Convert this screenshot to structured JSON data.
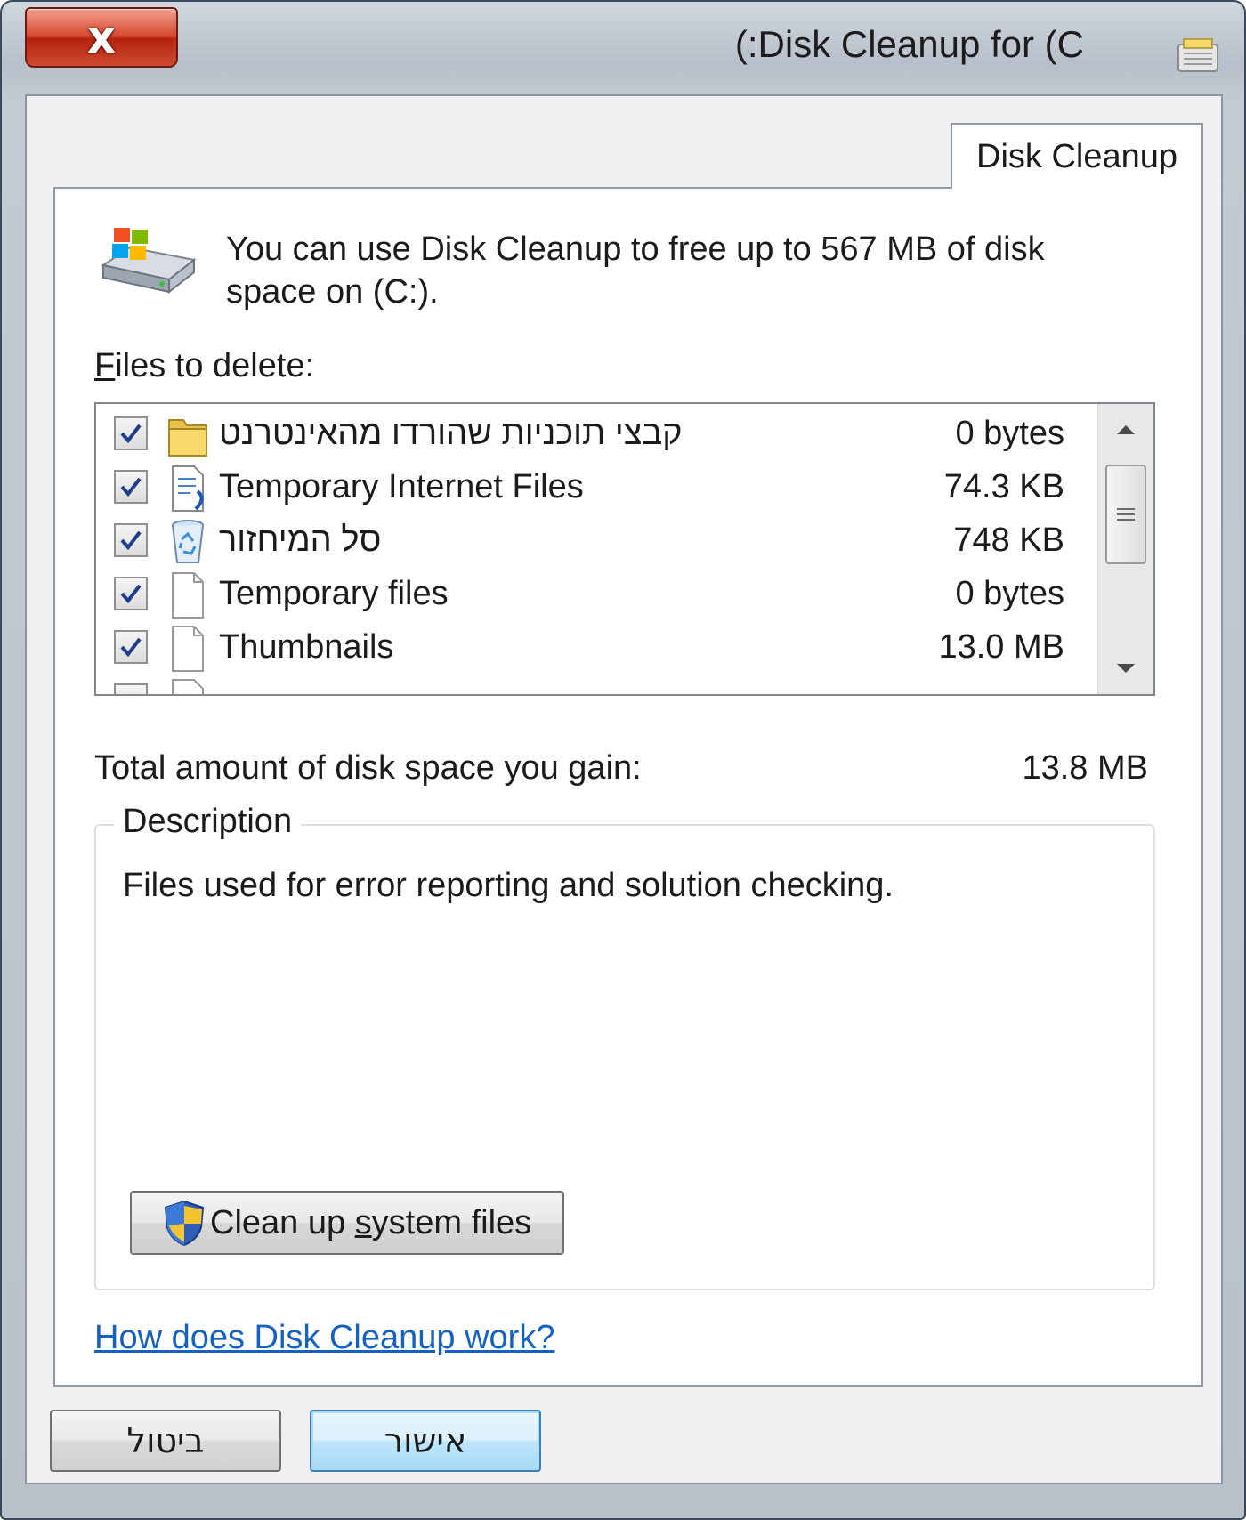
{
  "window": {
    "title": "(:Disk Cleanup for  (C",
    "close_label": "x"
  },
  "tab": {
    "label": "Disk Cleanup"
  },
  "intro": {
    "text": "You can use Disk Cleanup to free up to 567 MB of disk space on  (C:)."
  },
  "files": {
    "label_prefix": "F",
    "label_rest": "iles to delete:",
    "items": [
      {
        "label": "קבצי תוכניות שהורדו מהאינטרנט",
        "size": "0 bytes",
        "checked": true,
        "icon": "folder-icon"
      },
      {
        "label": "Temporary Internet Files",
        "size": "74.3 KB",
        "checked": true,
        "icon": "document-icon"
      },
      {
        "label": "סל המיחזור",
        "size": "748 KB",
        "checked": true,
        "icon": "recycle-bin-icon"
      },
      {
        "label": "Temporary files",
        "size": "0 bytes",
        "checked": true,
        "icon": "blank-page-icon"
      },
      {
        "label": "Thumbnails",
        "size": "13.0 MB",
        "checked": true,
        "icon": "blank-page-icon"
      }
    ]
  },
  "total": {
    "label": "Total amount of disk space you gain:",
    "value": "13.8 MB"
  },
  "description": {
    "title": "Description",
    "text": "Files used for error reporting and solution checking."
  },
  "system_button": {
    "label_pre": "Clean up ",
    "label_accel": "s",
    "label_post": "ystem files"
  },
  "help_link": {
    "text": "How does Disk Cleanup work?"
  },
  "buttons": {
    "cancel": "ביטול",
    "ok": "אישור"
  },
  "colors": {
    "link": "#1561c1",
    "close_button": "#c8361e",
    "ok_border": "#3c7fb1"
  }
}
